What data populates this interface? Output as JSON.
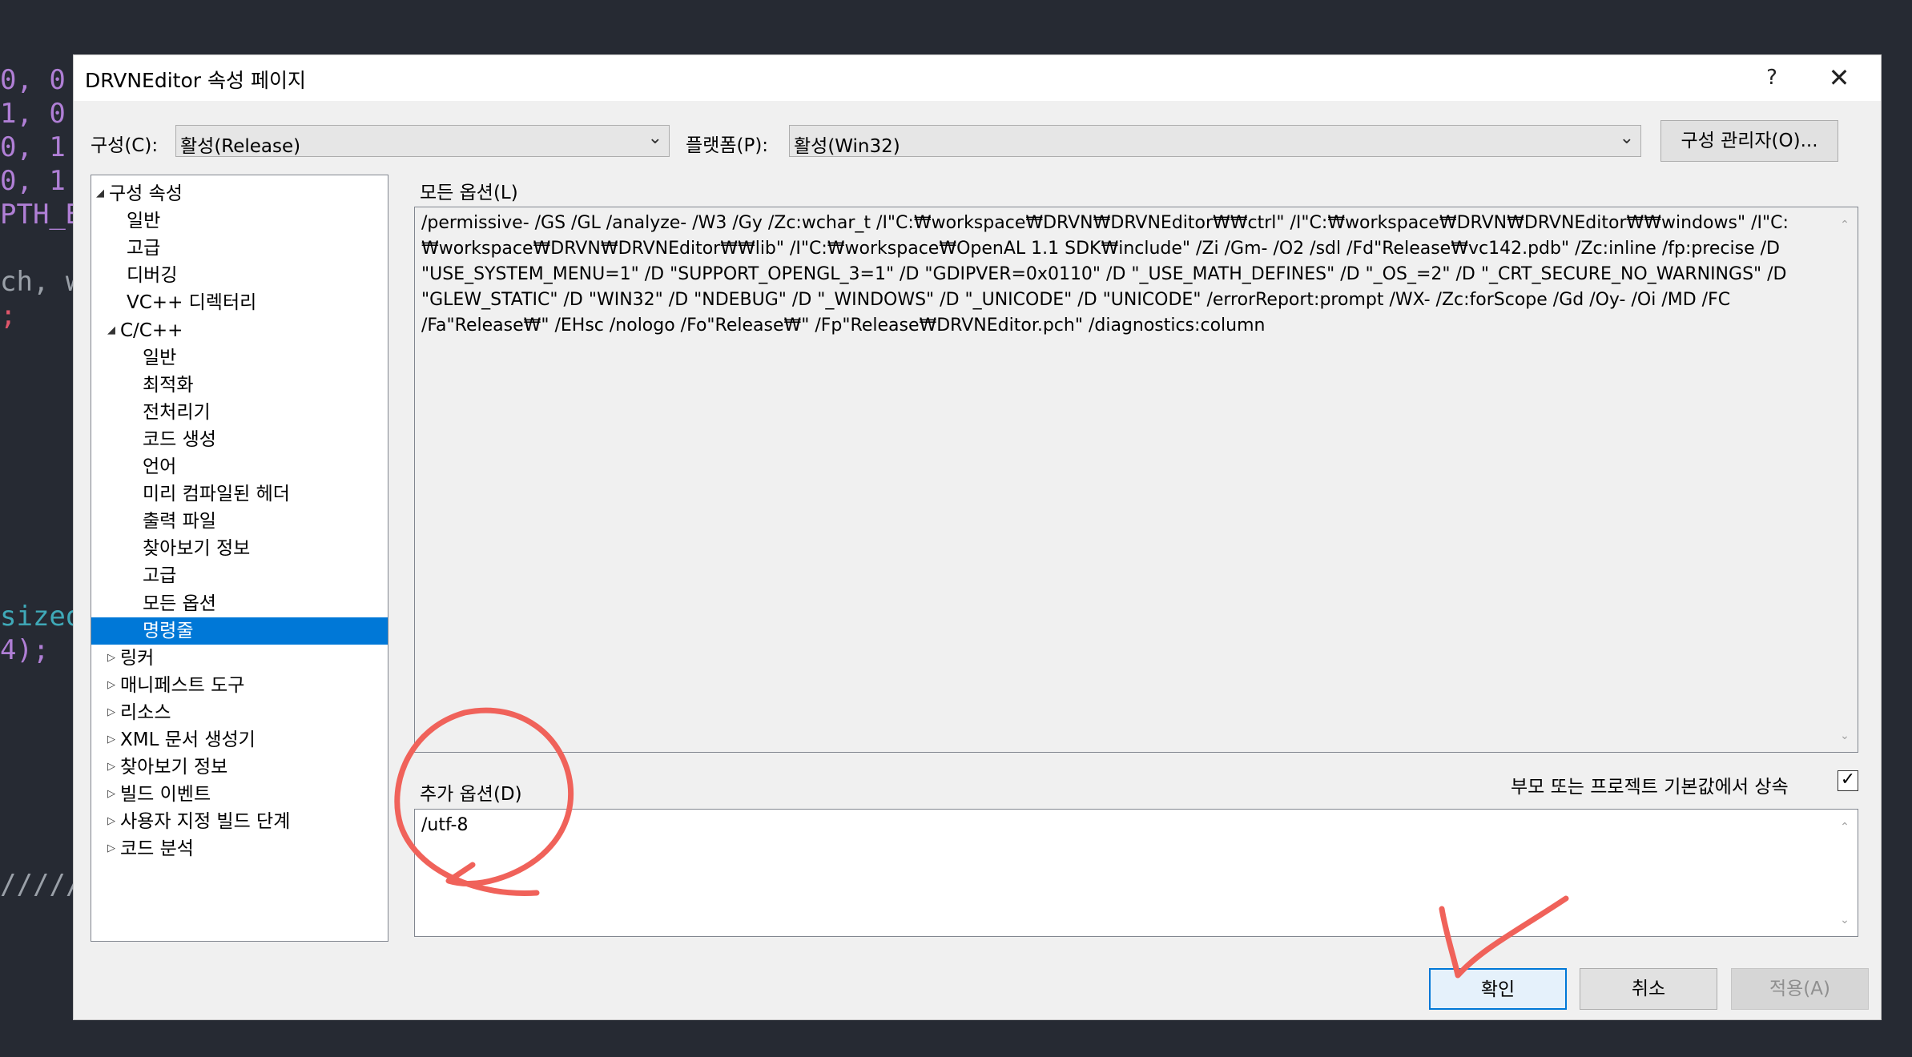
{
  "background_code": {
    "line1": "0, 0",
    "line2": "1, 0",
    "line3": "0, 1",
    "line4": "0, 1",
    "line5": "PTH_BU",
    "line6": "ch, w",
    "line7": ";",
    "line8": "sizeof",
    "line9": "4);",
    "line10": "/////"
  },
  "dialog": {
    "title": "DRVNEditor 속성 페이지",
    "help_label": "?",
    "close_label": "✕"
  },
  "config": {
    "label": "구성(C):",
    "value": "활성(Release)",
    "platform_label": "플랫폼(P):",
    "platform_value": "활성(Win32)",
    "manager_label": "구성 관리자(O)..."
  },
  "tree": {
    "items": [
      {
        "label": "구성 속성",
        "expander": "◢"
      },
      {
        "label": "일반"
      },
      {
        "label": "고급"
      },
      {
        "label": "디버깅"
      },
      {
        "label": "VC++ 디렉터리"
      },
      {
        "label": "C/C++",
        "expander": "◢"
      },
      {
        "label": "일반"
      },
      {
        "label": "최적화"
      },
      {
        "label": "전처리기"
      },
      {
        "label": "코드 생성"
      },
      {
        "label": "언어"
      },
      {
        "label": "미리 컴파일된 헤더"
      },
      {
        "label": "출력 파일"
      },
      {
        "label": "찾아보기 정보"
      },
      {
        "label": "고급"
      },
      {
        "label": "모든 옵션"
      },
      {
        "label": "명령줄"
      },
      {
        "label": "링커",
        "expander": "▷"
      },
      {
        "label": "매니페스트 도구",
        "expander": "▷"
      },
      {
        "label": "리소스",
        "expander": "▷"
      },
      {
        "label": "XML 문서 생성기",
        "expander": "▷"
      },
      {
        "label": "찾아보기 정보",
        "expander": "▷"
      },
      {
        "label": "빌드 이벤트",
        "expander": "▷"
      },
      {
        "label": "사용자 지정 빌드 단계",
        "expander": "▷"
      },
      {
        "label": "코드 분석",
        "expander": "▷"
      }
    ],
    "selected": "명령줄"
  },
  "all_options": {
    "label": "모든 옵션(L)",
    "text": "/permissive- /GS /GL /analyze- /W3 /Gy /Zc:wchar_t /I\"C:₩workspace₩DRVN₩DRVNEditor₩₩ctrl\" /I\"C:₩workspace₩DRVN₩DRVNEditor₩₩windows\" /I\"C:₩workspace₩DRVN₩DRVNEditor₩₩lib\" /I\"C:₩workspace₩OpenAL 1.1 SDK₩include\" /Zi /Gm- /O2 /sdl /Fd\"Release₩vc142.pdb\" /Zc:inline /fp:precise /D \"USE_SYSTEM_MENU=1\" /D \"SUPPORT_OPENGL_3=1\" /D \"GDIPVER=0x0110\" /D \"_USE_MATH_DEFINES\" /D \"_OS_=2\" /D \"_CRT_SECURE_NO_WARNINGS\" /D \"GLEW_STATIC\" /D \"WIN32\" /D \"NDEBUG\" /D \"_WINDOWS\" /D \"_UNICODE\" /D \"UNICODE\" /errorReport:prompt /WX- /Zc:forScope /Gd /Oy- /Oi /MD /FC /Fa\"Release₩\" /EHsc /nologo /Fo\"Release₩\" /Fp\"Release₩DRVNEditor.pch\" /diagnostics:column"
  },
  "additional_options": {
    "label": "추가 옵션(D)",
    "value": "/utf-8",
    "inherit_label": "부모 또는 프로젝트 기본값에서 상속",
    "inherit_checked": "✓"
  },
  "buttons": {
    "ok": "확인",
    "cancel": "취소",
    "apply": "적용(A)"
  },
  "colors": {
    "selection": "#0078d7",
    "annotation": "#f0625a"
  }
}
